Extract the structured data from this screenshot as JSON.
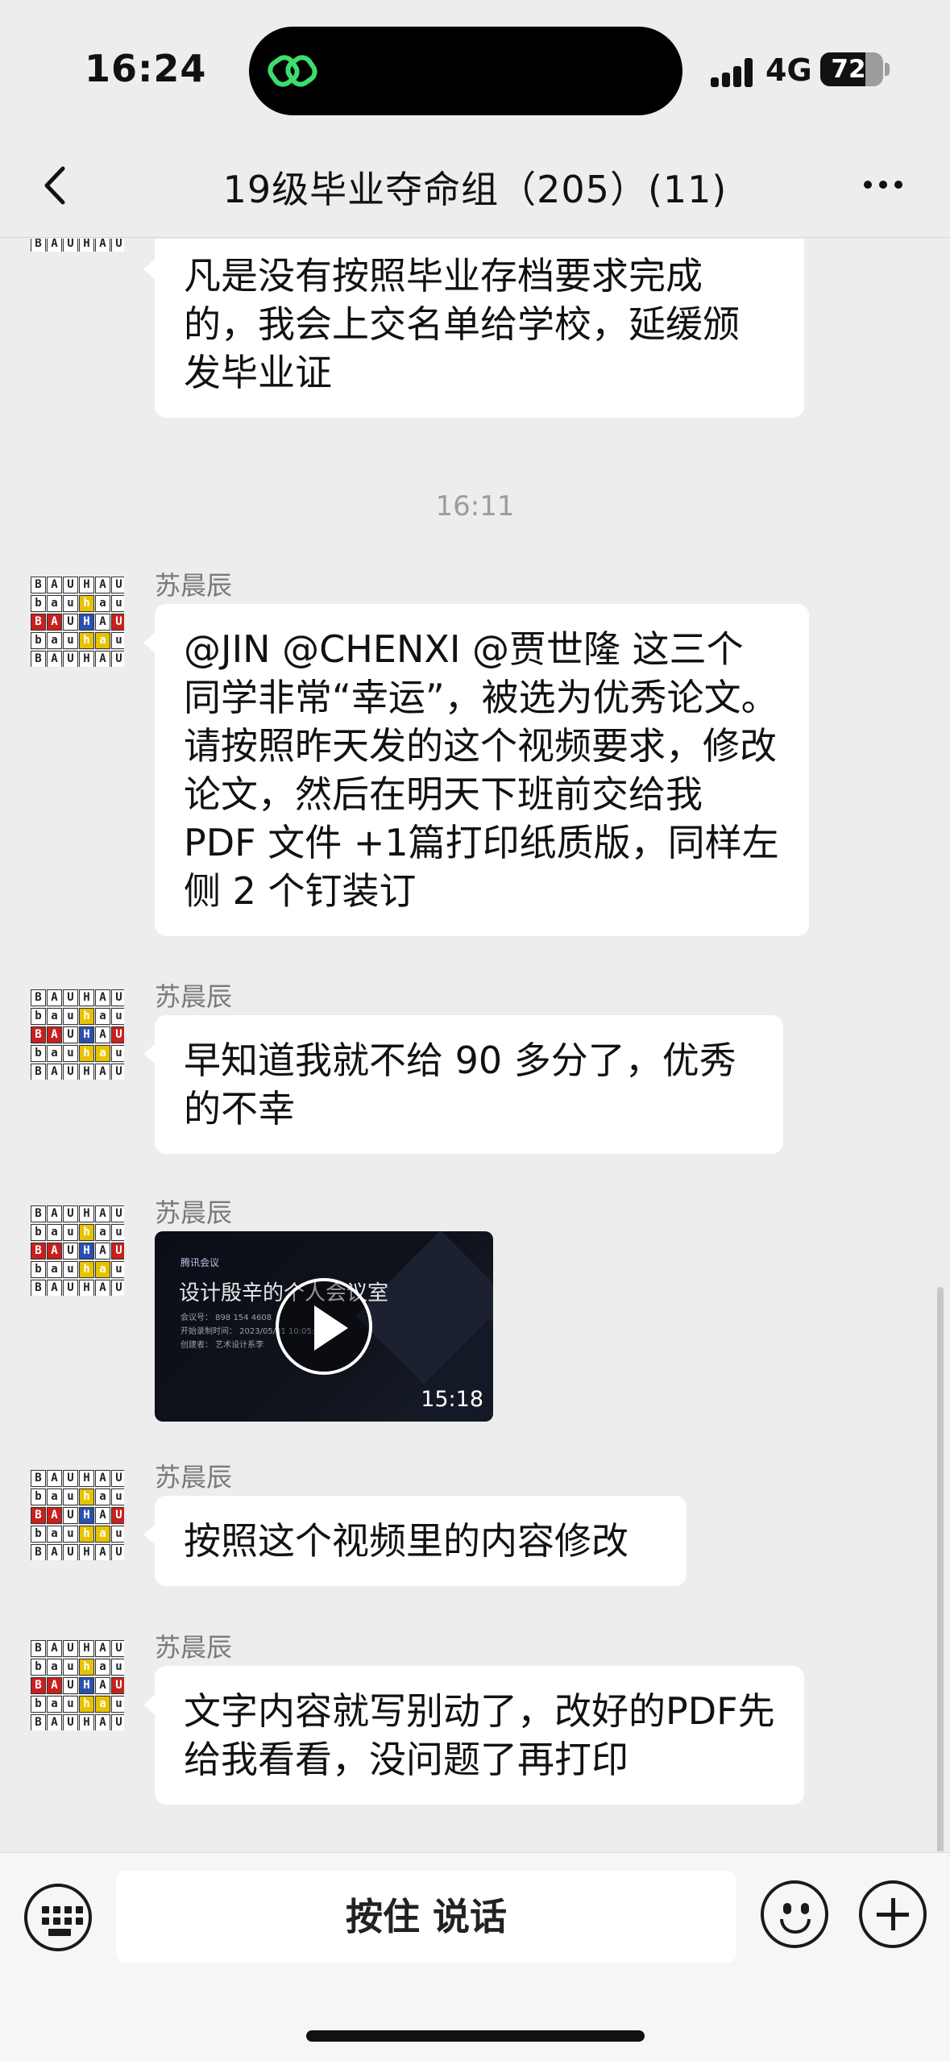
{
  "status_bar": {
    "time": "16:24",
    "network": "4G",
    "battery": "72",
    "battery_level": 0.72,
    "signal_icon": "signal-bars-icon",
    "app_icon": "link-chain-icon"
  },
  "nav": {
    "title": "19级毕业夺命组（205）(11)",
    "back_icon": "chevron-left-icon",
    "more_icon": "ellipsis-icon"
  },
  "chat": {
    "time_separator": "16:11",
    "avatar_rows": [
      "BAUHAUS",
      "bauhaus",
      "BAUHAUS",
      "bauhaus",
      "BAUHAUS"
    ],
    "messages": [
      {
        "sender": "",
        "text": "凡是没有按照毕业存档要求完成的，我会上交名单给学校，延缓颁发毕业证"
      },
      {
        "sender": "苏晨辰",
        "text": "@JIN @CHENXI @贾世隆 这三个同学非常“幸运”，被选为优秀论文。请按照昨天发的这个视频要求，修改论文，然后在明天下班前交给我 PDF 文件 +1篇打印纸质版，同样左侧 2 个钉装订"
      },
      {
        "sender": "苏晨辰",
        "text": "早知道我就不给 90 多分了，优秀的不幸"
      },
      {
        "sender": "苏晨辰",
        "type": "video",
        "video": {
          "brand": "腾讯会议",
          "title": "设计殷辛的个人会议室",
          "meeting_no": "会议号： 898 154 4608",
          "start": "开始录制时间： 2023/05/31 10:05:2",
          "creator": "创建者： 艺术设计系李",
          "duration": "15:18"
        }
      },
      {
        "sender": "苏晨辰",
        "text": "按照这个视频里的内容修改"
      },
      {
        "sender": "苏晨辰",
        "text": "文字内容就写别动了，改好的PDF先给我看看，没问题了再打印"
      }
    ]
  },
  "input_bar": {
    "talk_label": "按住 说话",
    "keyboard_icon": "keyboard-icon",
    "emoji_icon": "emoji-icon",
    "plus_icon": "plus-icon"
  }
}
